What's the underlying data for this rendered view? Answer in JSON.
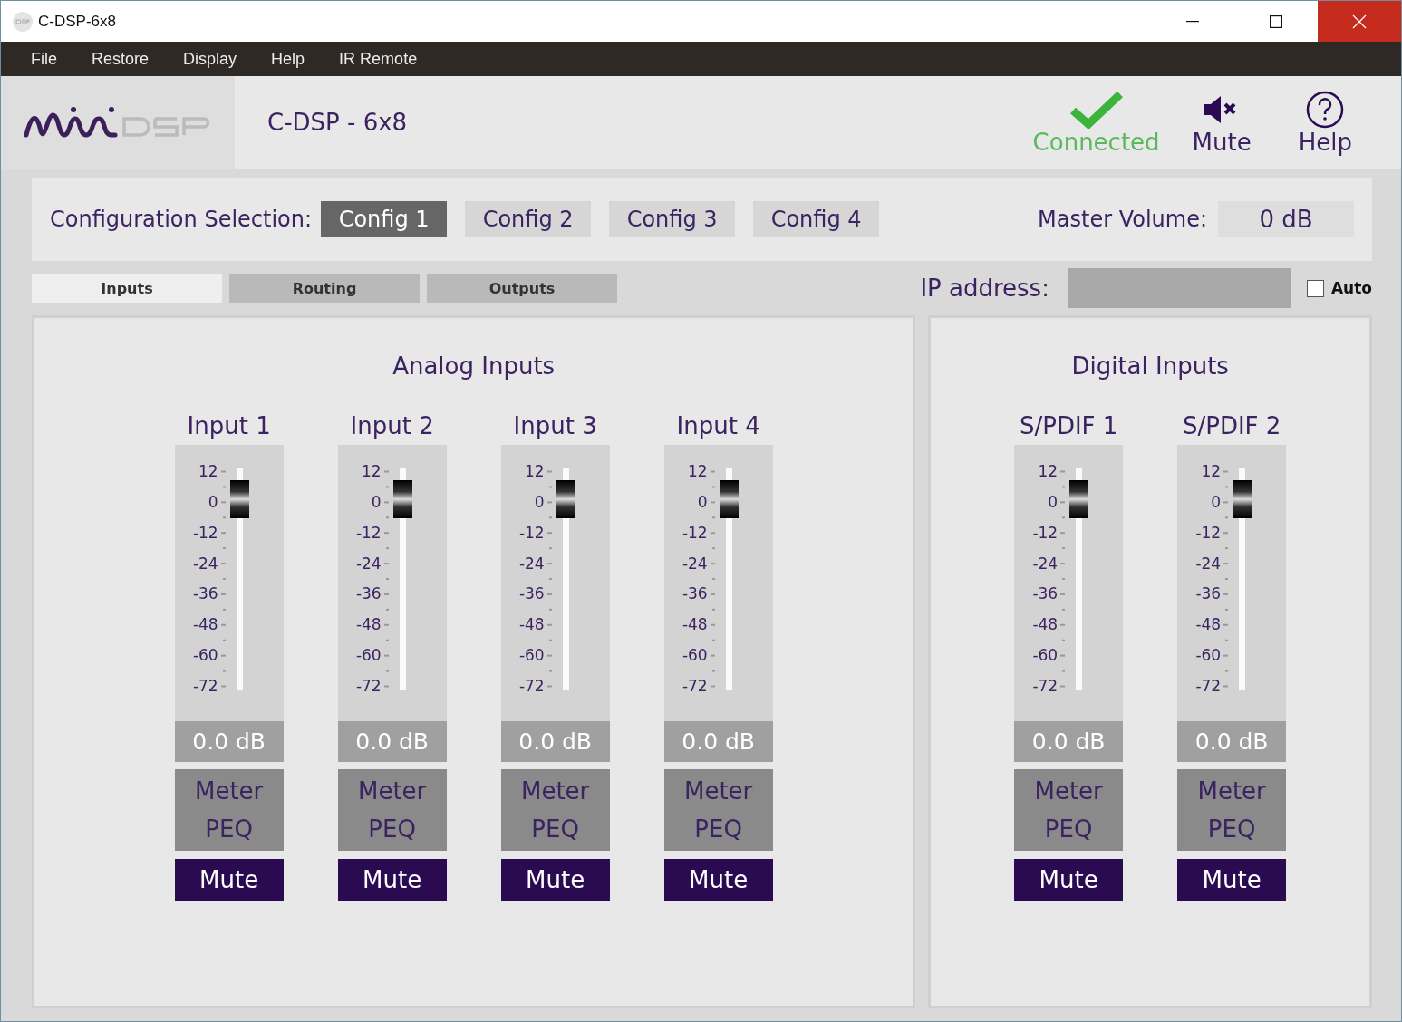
{
  "window": {
    "title": "C-DSP-6x8"
  },
  "menu": [
    "File",
    "Restore",
    "Display",
    "Help",
    "IR Remote"
  ],
  "header": {
    "device": "C-DSP - 6x8",
    "status": "Connected",
    "mute": "Mute",
    "help": "Help"
  },
  "config": {
    "label": "Configuration Selection:",
    "options": [
      {
        "label": "Config 1",
        "selected": true
      },
      {
        "label": "Config 2",
        "selected": false
      },
      {
        "label": "Config 3",
        "selected": false
      },
      {
        "label": "Config 4",
        "selected": false
      }
    ],
    "master_label": "Master Volume:",
    "master_value": "0 dB"
  },
  "tabs": [
    {
      "label": "Inputs",
      "selected": true
    },
    {
      "label": "Routing",
      "selected": false
    },
    {
      "label": "Outputs",
      "selected": false
    }
  ],
  "ip": {
    "label": "IP address:",
    "auto_label": "Auto",
    "auto_checked": false
  },
  "groups": [
    {
      "title": "Analog Inputs",
      "channels": [
        {
          "name": "Input 1",
          "scale": [
            "12",
            "0",
            "-12",
            "-24",
            "-36",
            "-48",
            "-60",
            "-72"
          ],
          "level": 0.857,
          "reading": "0.0 dB",
          "buttons": [
            "Meter",
            "PEQ"
          ],
          "mute": "Mute"
        },
        {
          "name": "Input 2",
          "scale": [
            "12",
            "0",
            "-12",
            "-24",
            "-36",
            "-48",
            "-60",
            "-72"
          ],
          "level": 0.857,
          "reading": "0.0 dB",
          "buttons": [
            "Meter",
            "PEQ"
          ],
          "mute": "Mute"
        },
        {
          "name": "Input 3",
          "scale": [
            "12",
            "0",
            "-12",
            "-24",
            "-36",
            "-48",
            "-60",
            "-72"
          ],
          "level": 0.857,
          "reading": "0.0 dB",
          "buttons": [
            "Meter",
            "PEQ"
          ],
          "mute": "Mute"
        },
        {
          "name": "Input 4",
          "scale": [
            "12",
            "0",
            "-12",
            "-24",
            "-36",
            "-48",
            "-60",
            "-72"
          ],
          "level": 0.857,
          "reading": "0.0 dB",
          "buttons": [
            "Meter",
            "PEQ"
          ],
          "mute": "Mute"
        }
      ]
    },
    {
      "title": "Digital Inputs",
      "channels": [
        {
          "name": "S/PDIF 1",
          "scale": [
            "12",
            "0",
            "-12",
            "-24",
            "-36",
            "-48",
            "-60",
            "-72"
          ],
          "level": 0.857,
          "reading": "0.0 dB",
          "buttons": [
            "Meter",
            "PEQ"
          ],
          "mute": "Mute"
        },
        {
          "name": "S/PDIF 2",
          "scale": [
            "12",
            "0",
            "-12",
            "-24",
            "-36",
            "-48",
            "-60",
            "-72"
          ],
          "level": 0.857,
          "reading": "0.0 dB",
          "buttons": [
            "Meter",
            "PEQ"
          ],
          "mute": "Mute"
        }
      ]
    }
  ]
}
